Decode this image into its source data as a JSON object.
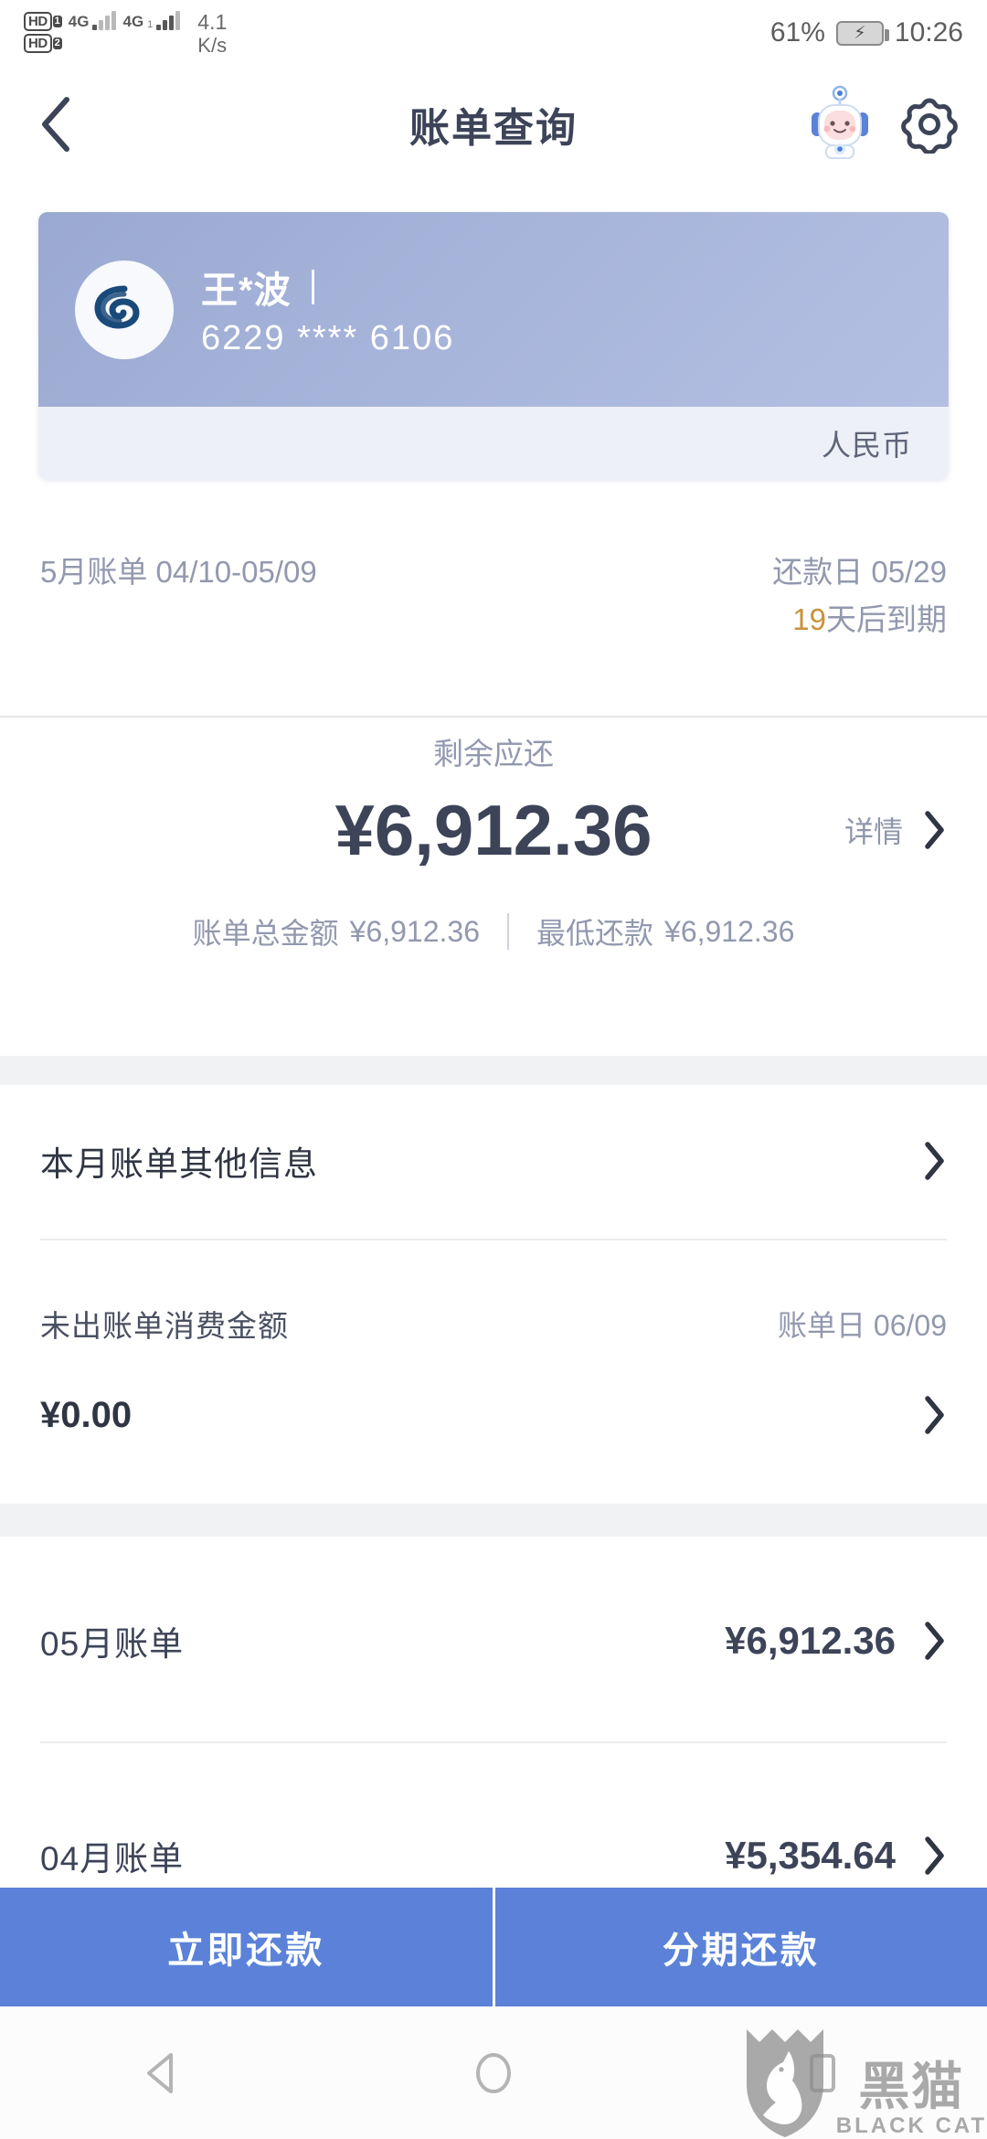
{
  "status_bar": {
    "hd1_label": "HD",
    "hd1_sim": "1",
    "hd2_label": "HD",
    "hd2_sim": "2",
    "net1": "4G",
    "net2": "4G",
    "net2_sub": "1",
    "speed_value": "4.1",
    "speed_unit": "K/s",
    "battery_percent": "61%",
    "time": "10:26"
  },
  "header": {
    "back_icon": "chevron-left-icon",
    "title": "账单查询",
    "mascot_icon": "robot-assistant-icon",
    "settings_icon": "gear-icon"
  },
  "card": {
    "bank_logo_icon": "cgb-spiral-logo",
    "holder_name": "王*波",
    "card_number": "6229 **** 6106",
    "currency": "人民币",
    "gradient_start": "#9aa9d2",
    "gradient_end": "#b3bfe2",
    "footer_bg": "#edf0f7"
  },
  "bill_period": {
    "period_label": "5月账单 04/10-05/09",
    "due_label": "还款日 05/29",
    "countdown_number": "19",
    "countdown_suffix": "天后到期",
    "countdown_color": "#c9923a"
  },
  "amount": {
    "label": "剩余应还",
    "value": "¥6,912.36",
    "detail_link": "详情",
    "detail_chevron_icon": "chevron-right-icon",
    "total_label": "账单总金额",
    "total_value": "¥6,912.36",
    "minimum_label": "最低还款",
    "minimum_value": "¥6,912.36"
  },
  "info_rows": {
    "other_info_label": "本月账单其他信息",
    "other_info_chevron": "chevron-right-icon",
    "unbilled_label": "未出账单消费金额",
    "statement_date_label": "账单日 06/09",
    "unbilled_value": "¥0.00",
    "unbilled_chevron": "chevron-right-icon"
  },
  "bill_history": [
    {
      "month_label": "05月账单",
      "amount": "¥6,912.36",
      "chevron": "chevron-right-icon"
    },
    {
      "month_label": "04月账单",
      "amount": "¥5,354.64",
      "chevron": "chevron-right-icon"
    }
  ],
  "actions": {
    "repay_now": "立即还款",
    "installment_repay": "分期还款",
    "button_color": "#5b82d8"
  },
  "nav_bar": {
    "back_icon": "triangle-back-icon",
    "home_icon": "circle-home-icon",
    "recents_icon": "square-recents-icon"
  },
  "watermark": {
    "cn_text": "黑猫",
    "en_text": "BLACK CAT",
    "shield_icon": "cat-shield-logo"
  }
}
